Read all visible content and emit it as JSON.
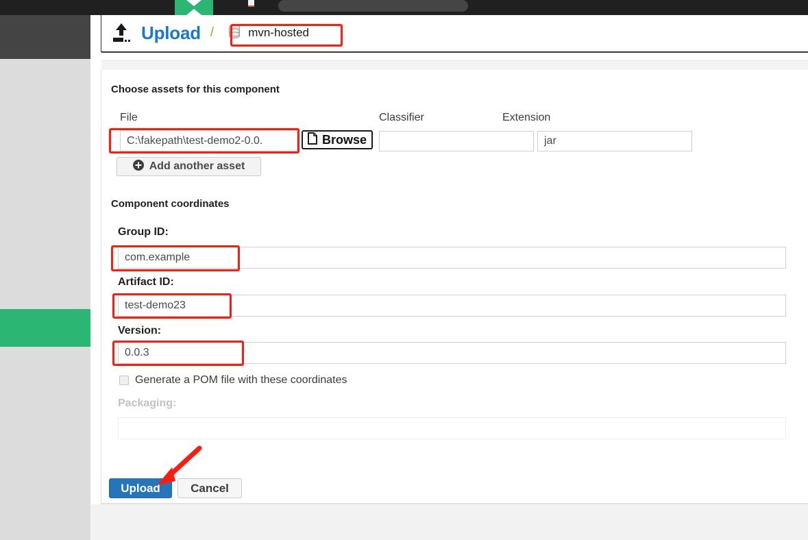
{
  "browser": {
    "tab_icon": "green-tab",
    "favicon": "page-favicon",
    "omnibox_value": ""
  },
  "header": {
    "upload_icon": "upload-icon",
    "title": "Upload",
    "separator": "/",
    "repo_icon": "database-icon",
    "repository": "mvn-hosted"
  },
  "assets": {
    "section_title": "Choose assets for this component",
    "labels": {
      "file": "File",
      "classifier": "Classifier",
      "extension": "Extension"
    },
    "file_value": "C:\\fakepath\\test-demo2-0.0.",
    "classifier_value": "",
    "extension_value": "jar",
    "browse_label": "Browse",
    "browse_icon": "file-icon",
    "add_asset_label": "Add another asset",
    "add_asset_icon": "plus-circle-icon"
  },
  "coordinates": {
    "section_title": "Component coordinates",
    "group_id_label": "Group ID:",
    "group_id_value": "com.example",
    "artifact_id_label": "Artifact ID:",
    "artifact_id_value": "test-demo23",
    "version_label": "Version:",
    "version_value": "0.0.3",
    "generate_pom_label": "Generate a POM file with these coordinates",
    "generate_pom_checked": false,
    "packaging_label": "Packaging:",
    "packaging_value": "",
    "packaging_disabled": true
  },
  "actions": {
    "upload_label": "Upload",
    "cancel_label": "Cancel"
  },
  "colors": {
    "accent_blue": "#1878d0",
    "button_blue": "#2575bb",
    "green": "#2bb673",
    "annotation_red": "#fe1c10",
    "top_bar": "#202020"
  }
}
